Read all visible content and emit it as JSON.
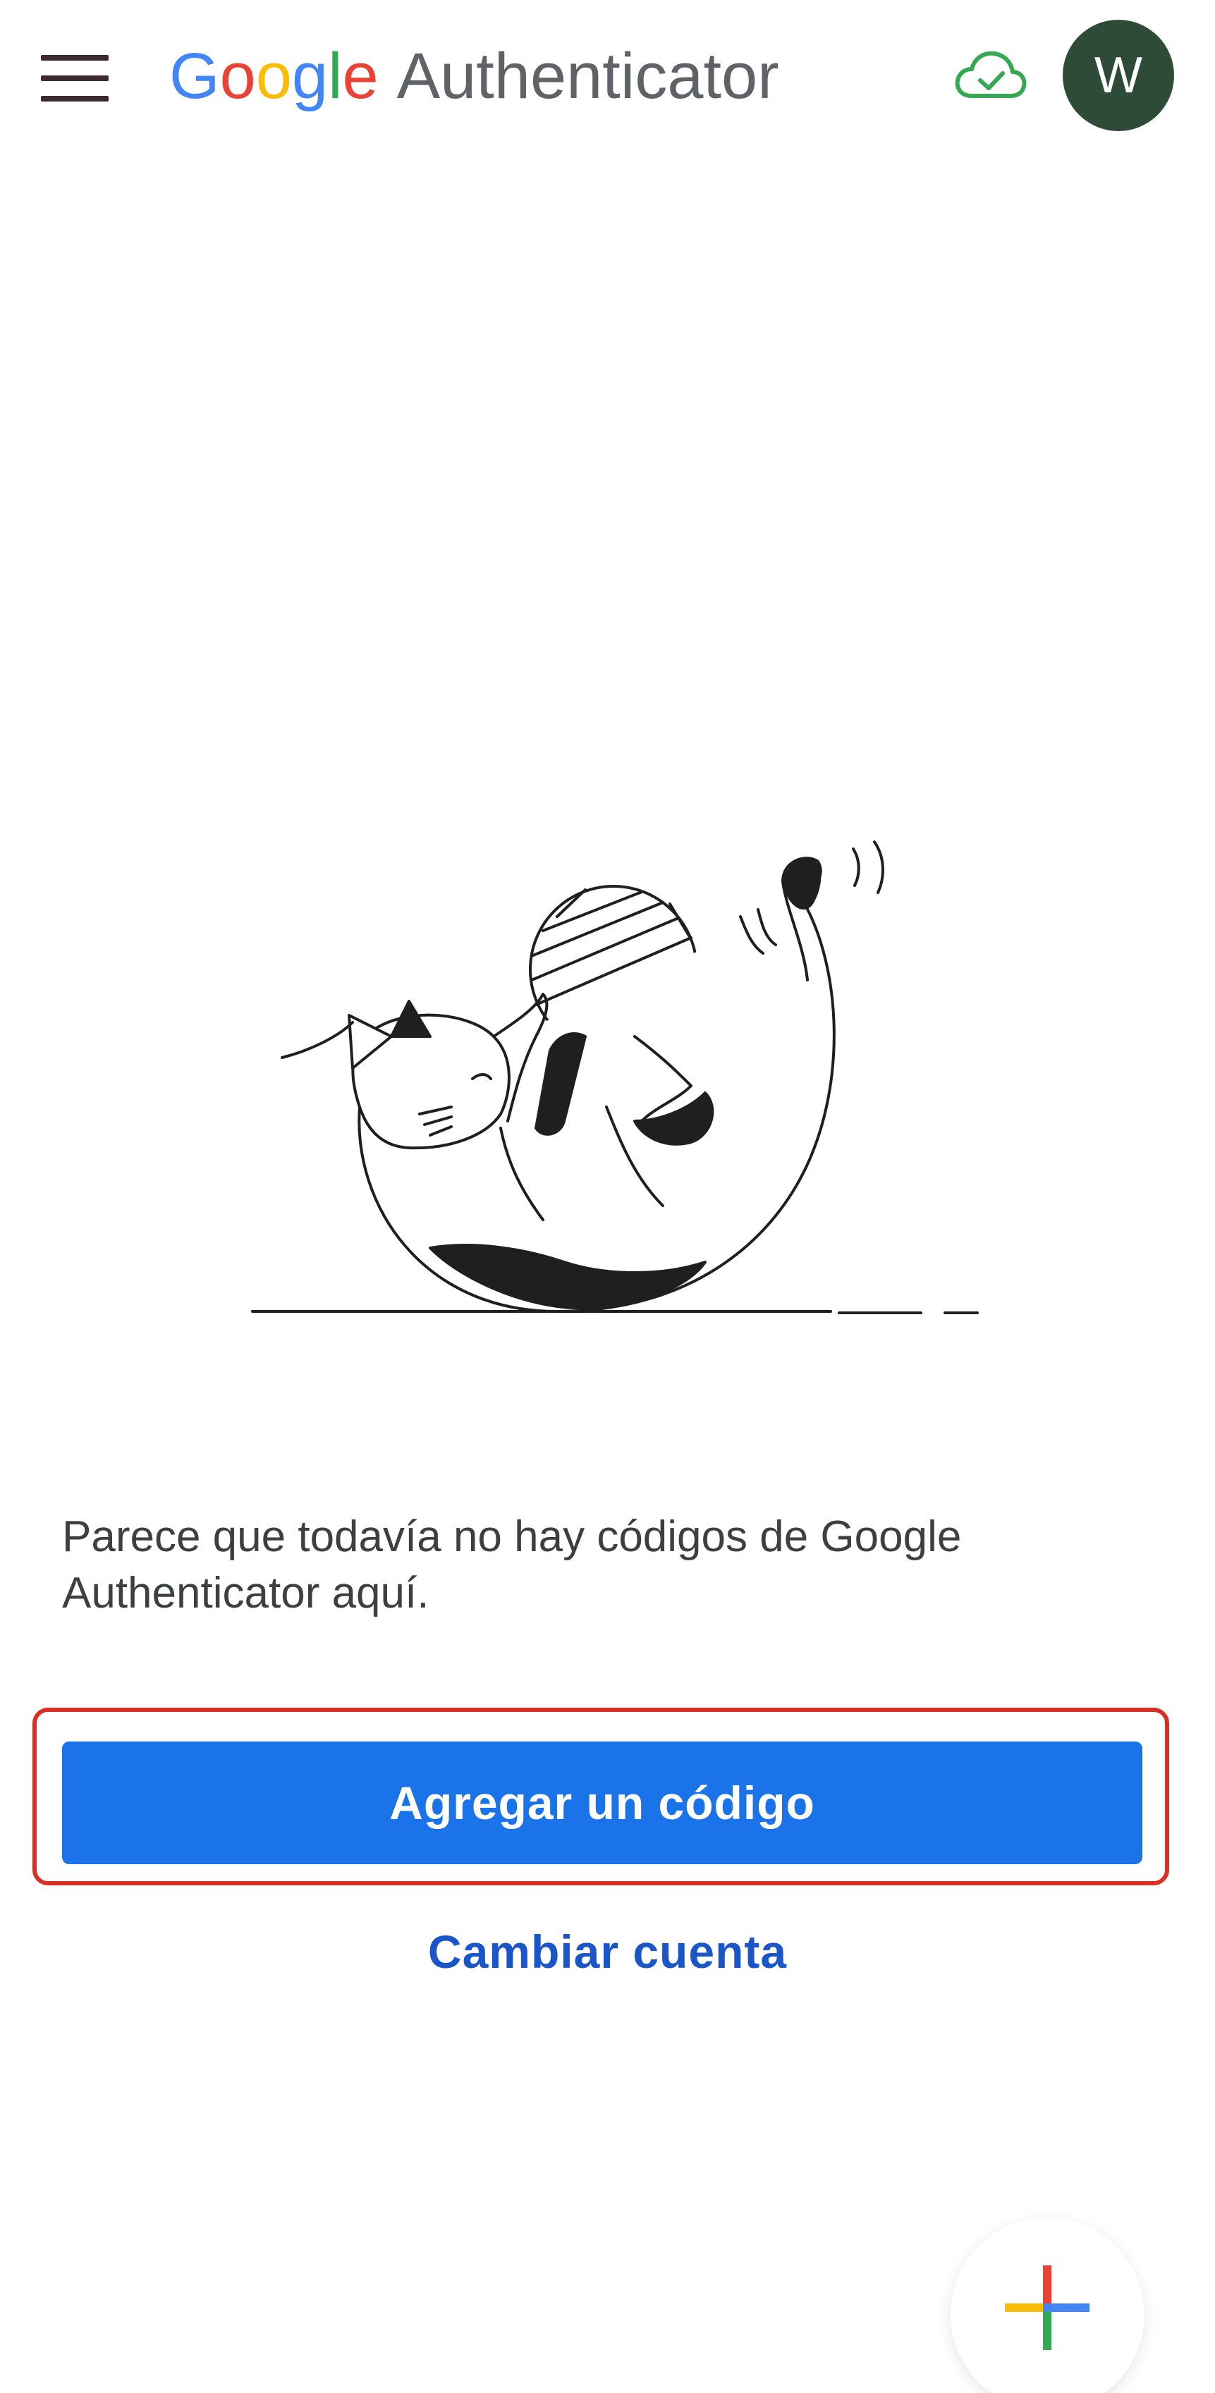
{
  "header": {
    "brand_google": [
      "G",
      "o",
      "o",
      "g",
      "l",
      "e"
    ],
    "brand_google_colors": [
      "#4285f4",
      "#ea4335",
      "#fbbc05",
      "#4285f4",
      "#34a853",
      "#ea4335"
    ],
    "brand_app": "Authenticator",
    "menu_icon": "hamburger-menu-icon",
    "sync_icon": "cloud-check-icon",
    "sync_color": "#34a853",
    "avatar_initial": "W",
    "avatar_color": "#2e4b37"
  },
  "illustration": {
    "icon": "cat-with-yarn-illustration"
  },
  "main": {
    "empty_message": "Parece que todavía no hay códigos de Google Authenticator aquí.",
    "add_code_label": "Agregar un código",
    "switch_account_label": "Cambiar cuenta",
    "highlight_color": "#d93025",
    "accent_color": "#1a73e8"
  },
  "fab": {
    "icon": "add-plus-icon"
  }
}
